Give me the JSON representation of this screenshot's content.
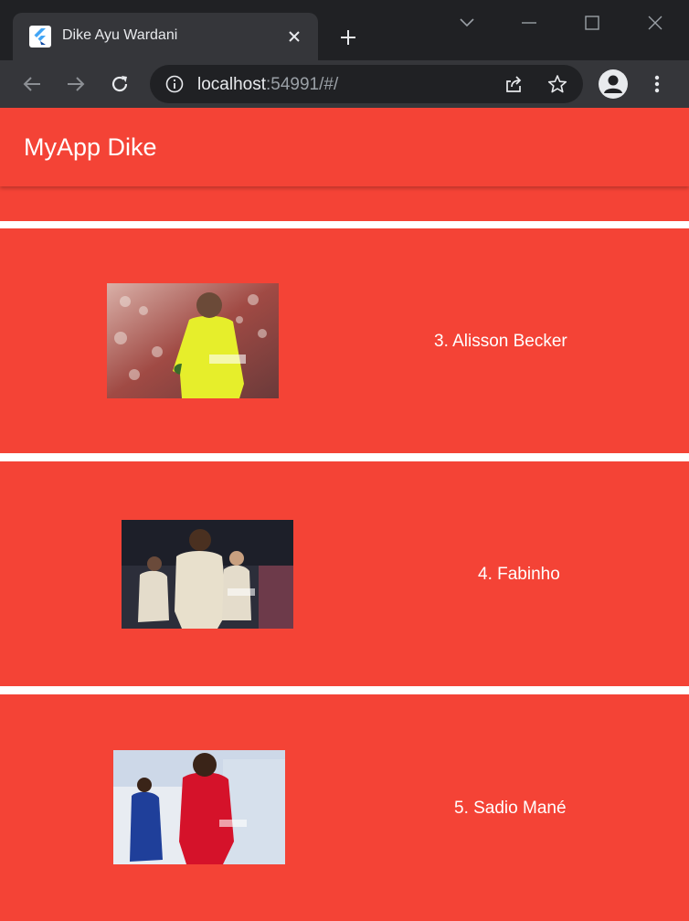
{
  "browser": {
    "tab_title": "Dike Ayu Wardani",
    "url_host": "localhost",
    "url_rest": ":54991/#/"
  },
  "app": {
    "title": "MyApp Dike",
    "accent_color": "#f44336"
  },
  "players": [
    {
      "name": "3. Alisson Becker"
    },
    {
      "name": "4. Fabinho"
    },
    {
      "name": "5. Sadio Mané"
    }
  ]
}
